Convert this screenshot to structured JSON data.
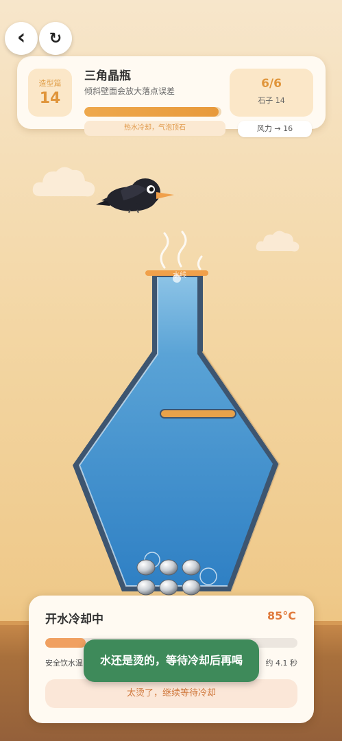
{
  "nav": {
    "back_icon": "chevron-left-icon",
    "back_glyph": "‹",
    "restart_icon": "refresh-icon",
    "restart_glyph": "↻"
  },
  "level": {
    "category": "造型篇",
    "number": "14",
    "title": "三角晶瓶",
    "subtitle": "倾斜壁面会放大落点误差",
    "progress": 0.98,
    "hint": "热水冷却，气泡顶石",
    "stone_count": "6/6",
    "stones_label": "石子 14",
    "wind": "风力 → 16"
  },
  "scene": {
    "water_line_label": "水线",
    "stones": 6,
    "water_color": "#3a8ec8",
    "bottle_outline": "#3d5570"
  },
  "cooling": {
    "title": "开水冷却中",
    "temperature": "85°C",
    "progress": 0.16,
    "left_text": "安全饮水温",
    "right_text": "约 4.1 秒",
    "button_label": "太烫了，继续等待冷却"
  },
  "toast": {
    "message": "水还是烫的，等待冷却后再喝"
  },
  "colors": {
    "accent": "#e0953b",
    "toast_bg": "#3e8a5a",
    "temp": "#e07a3c"
  }
}
